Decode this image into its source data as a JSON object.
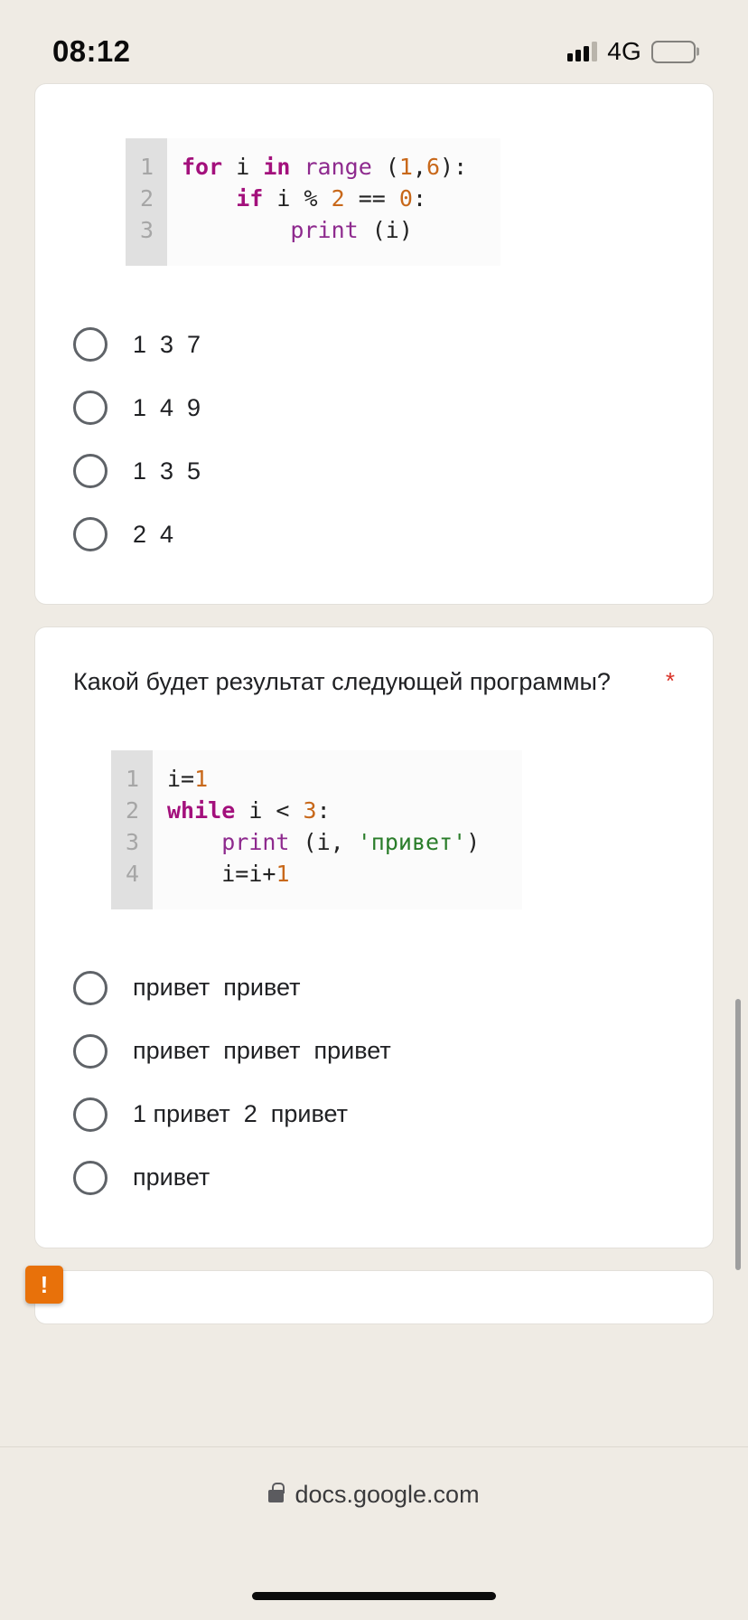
{
  "status_bar": {
    "time": "08:12",
    "network": "4G",
    "signal_icon": "signal-bars-icon",
    "battery_icon": "battery-full-icon"
  },
  "form": {
    "questions": [
      {
        "id": "q1",
        "text": "",
        "required_marker": "",
        "code": {
          "line_numbers": "1\n2\n3",
          "lines": [
            [
              {
                "t": "for",
                "c": "kw"
              },
              {
                "t": " i ",
                "c": "op"
              },
              {
                "t": "in",
                "c": "kw"
              },
              {
                "t": " ",
                "c": "op"
              },
              {
                "t": "range",
                "c": "fn"
              },
              {
                "t": " (",
                "c": "op"
              },
              {
                "t": "1",
                "c": "num"
              },
              {
                "t": ",",
                "c": "op"
              },
              {
                "t": "6",
                "c": "num"
              },
              {
                "t": "):",
                "c": "op"
              }
            ],
            [
              {
                "t": "    ",
                "c": "op"
              },
              {
                "t": "if",
                "c": "kw"
              },
              {
                "t": " i % ",
                "c": "op"
              },
              {
                "t": "2",
                "c": "num"
              },
              {
                "t": " == ",
                "c": "op"
              },
              {
                "t": "0",
                "c": "num"
              },
              {
                "t": ":",
                "c": "op"
              }
            ],
            [
              {
                "t": "        ",
                "c": "op"
              },
              {
                "t": "print",
                "c": "fn"
              },
              {
                "t": " (i)",
                "c": "op"
              }
            ]
          ]
        },
        "options": [
          "1  3  7",
          "1  4  9",
          "1  3  5",
          "2  4"
        ]
      },
      {
        "id": "q2",
        "text": "Какой будет результат следующей программы?",
        "required_marker": "*",
        "code": {
          "line_numbers": "1\n2\n3\n4",
          "lines": [
            [
              {
                "t": "i=",
                "c": "op"
              },
              {
                "t": "1",
                "c": "num"
              }
            ],
            [
              {
                "t": "while",
                "c": "kw"
              },
              {
                "t": " i < ",
                "c": "op"
              },
              {
                "t": "3",
                "c": "num"
              },
              {
                "t": ":",
                "c": "op"
              }
            ],
            [
              {
                "t": "    ",
                "c": "op"
              },
              {
                "t": "print",
                "c": "fn"
              },
              {
                "t": " (i, ",
                "c": "op"
              },
              {
                "t": "'привет'",
                "c": "str"
              },
              {
                "t": ")",
                "c": "op"
              }
            ],
            [
              {
                "t": "    ",
                "c": "op"
              },
              {
                "t": "i=i+",
                "c": "op"
              },
              {
                "t": "1",
                "c": "num"
              }
            ]
          ]
        },
        "options": [
          "привет  привет",
          "привет  привет  привет",
          "1 привет  2  привет",
          "привет"
        ]
      }
    ]
  },
  "error_badge": {
    "glyph": "!",
    "color": "#e8710a"
  },
  "browser_footer": {
    "url": "docs.google.com",
    "lock_icon": "lock-icon"
  },
  "colors": {
    "page_background": "#efebe4",
    "card_background": "#ffffff",
    "required_red": "#d93025",
    "keyword_purple": "#a3107c",
    "number_orange": "#c8681a",
    "string_green": "#2a7d2a"
  }
}
